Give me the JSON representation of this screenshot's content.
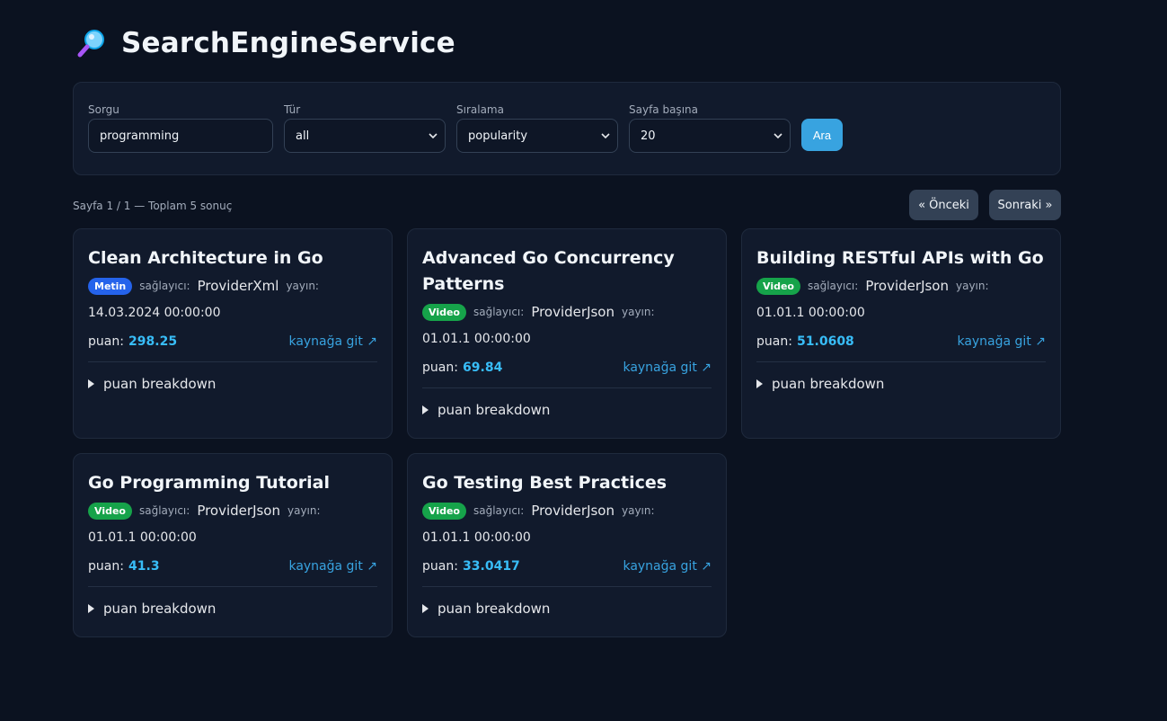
{
  "app": {
    "title": "SearchEngineService",
    "icon": "magnifier-icon"
  },
  "search": {
    "query_label": "Sorgu",
    "query_value": "programming",
    "type_label": "Tür",
    "type_value": "all",
    "sort_label": "Sıralama",
    "sort_value": "popularity",
    "per_page_label": "Sayfa başına",
    "per_page_value": "20",
    "submit_label": "Ara"
  },
  "pagination": {
    "info": "Sayfa 1 / 1 — Toplam 5 sonuç",
    "prev_label": "« Önceki",
    "next_label": "Sonraki »"
  },
  "labels": {
    "provider": "sağlayıcı:",
    "published": "yayın:",
    "score": "puan:",
    "source_link": "kaynağa git ↗",
    "breakdown": "puan breakdown"
  },
  "results": [
    {
      "title": "Clean Architecture in Go",
      "type": "Metin",
      "provider": "ProviderXml",
      "date": "14.03.2024 00:00:00",
      "score": "298.25"
    },
    {
      "title": "Advanced Go Concurrency Patterns",
      "type": "Video",
      "provider": "ProviderJson",
      "date": "01.01.1 00:00:00",
      "score": "69.84"
    },
    {
      "title": "Building RESTful APIs with Go",
      "type": "Video",
      "provider": "ProviderJson",
      "date": "01.01.1 00:00:00",
      "score": "51.0608"
    },
    {
      "title": "Go Programming Tutorial",
      "type": "Video",
      "provider": "ProviderJson",
      "date": "01.01.1 00:00:00",
      "score": "41.3"
    },
    {
      "title": "Go Testing Best Practices",
      "type": "Video",
      "provider": "ProviderJson",
      "date": "01.01.1 00:00:00",
      "score": "33.0417"
    }
  ],
  "colors": {
    "background": "#0b1220",
    "panel": "#111a2c",
    "accent": "#38a3e0",
    "badge_text": "#2563eb",
    "badge_video": "#16a34a"
  }
}
